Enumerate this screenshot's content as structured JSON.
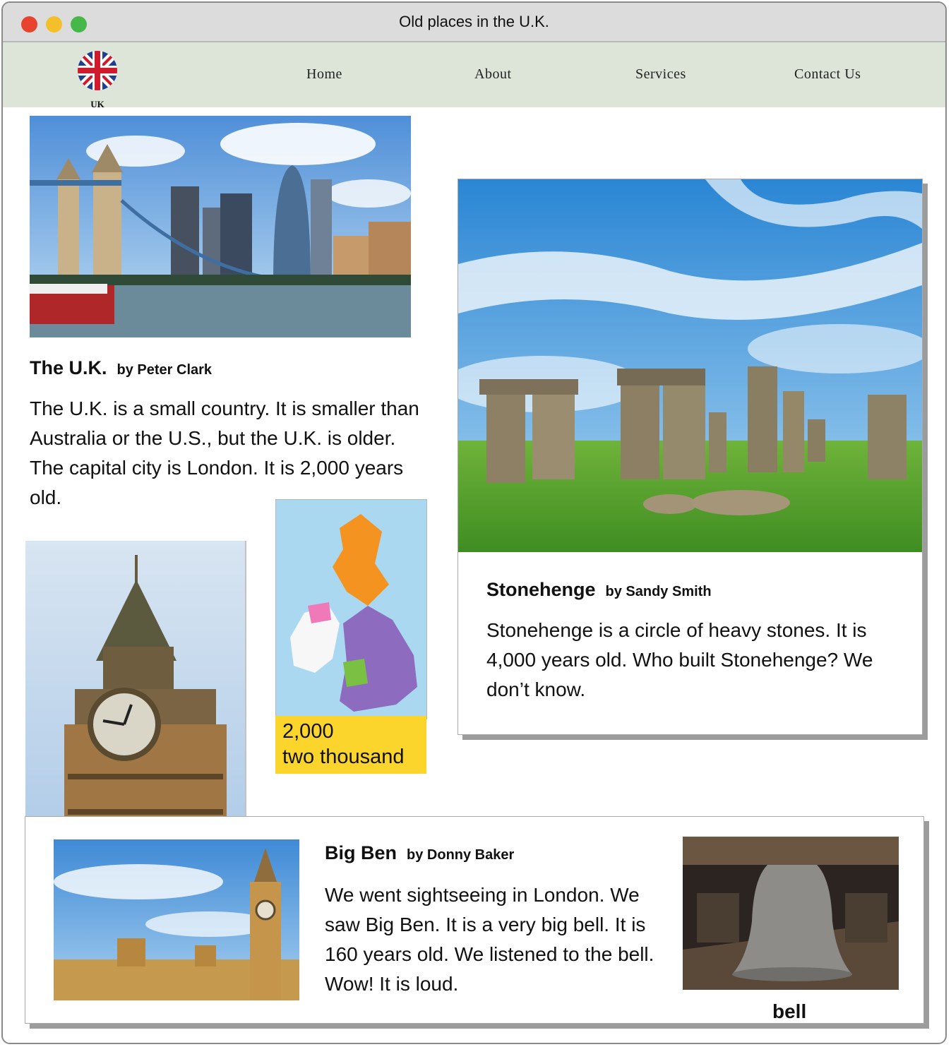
{
  "window": {
    "title": "Old places in the U.K."
  },
  "nav": {
    "logo_caption": "UK",
    "items": [
      "Home",
      "About",
      "Services",
      "Contact Us"
    ]
  },
  "articles": {
    "uk": {
      "title": "The U.K.",
      "byline": "by Peter Clark",
      "text": "The U.K. is a small country. It is smaller than Australia or the U.S., but the U.K. is older. The capital city is London. It is 2,000 years old."
    },
    "stonehenge": {
      "title": "Stonehenge",
      "byline": "by Sandy Smith",
      "text": "Stonehenge is a circle of heavy stones. It is 4,000 years old. Who built Stonehenge? We don’t know."
    },
    "bigben": {
      "title": "Big Ben",
      "byline": "by Donny Baker",
      "text": "We went sightseeing in London. We saw Big Ben. It is a very big bell. It is 160 years old. We listened to the bell. Wow! It is loud."
    }
  },
  "map_label": {
    "number": "2,000",
    "words": "two thousand"
  },
  "bell_caption": "bell",
  "colors": {
    "navbar": "#dde5d8",
    "titlebar": "#dcdcdc",
    "label_yellow": "#fcd52c"
  }
}
